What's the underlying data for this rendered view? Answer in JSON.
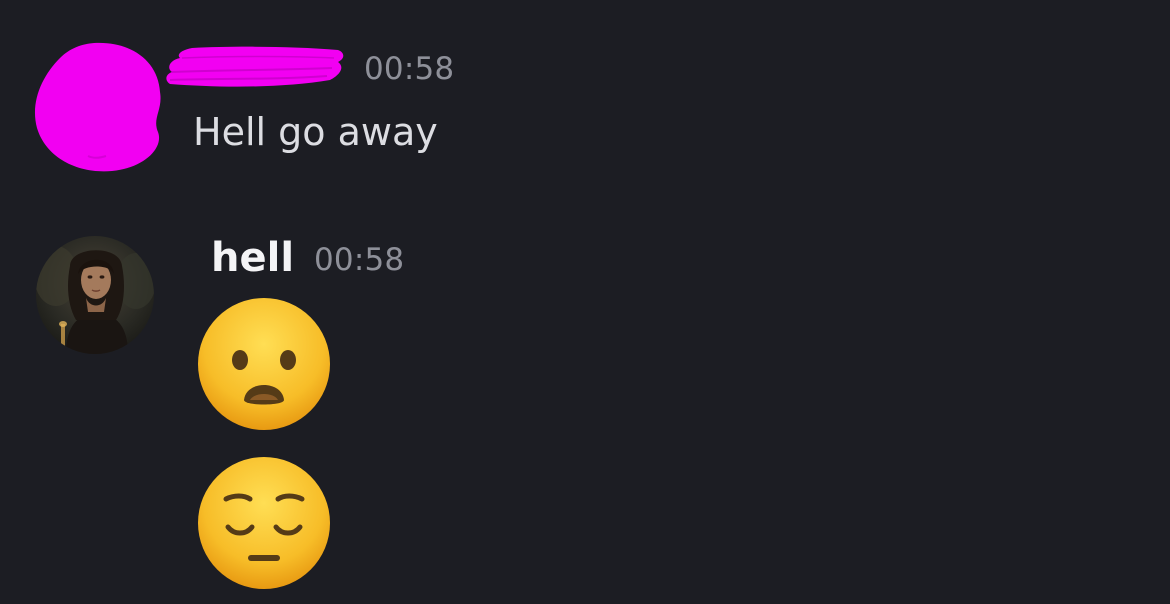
{
  "messages": [
    {
      "author": "",
      "author_redacted": true,
      "avatar_redacted": true,
      "timestamp": "00:58",
      "content": "Hell go away"
    },
    {
      "author": "hell",
      "avatar": "profile-photo",
      "timestamp": "00:58",
      "emojis": [
        "frowning-face-with-open-mouth",
        "pensive-face"
      ]
    }
  ],
  "colors": {
    "background": "#1c1d23",
    "redaction": "#f200f2",
    "timestamp": "#8e9099",
    "message_text": "#dcdde2",
    "username": "#f4f4f6",
    "emoji_face": "#f7bd28"
  }
}
